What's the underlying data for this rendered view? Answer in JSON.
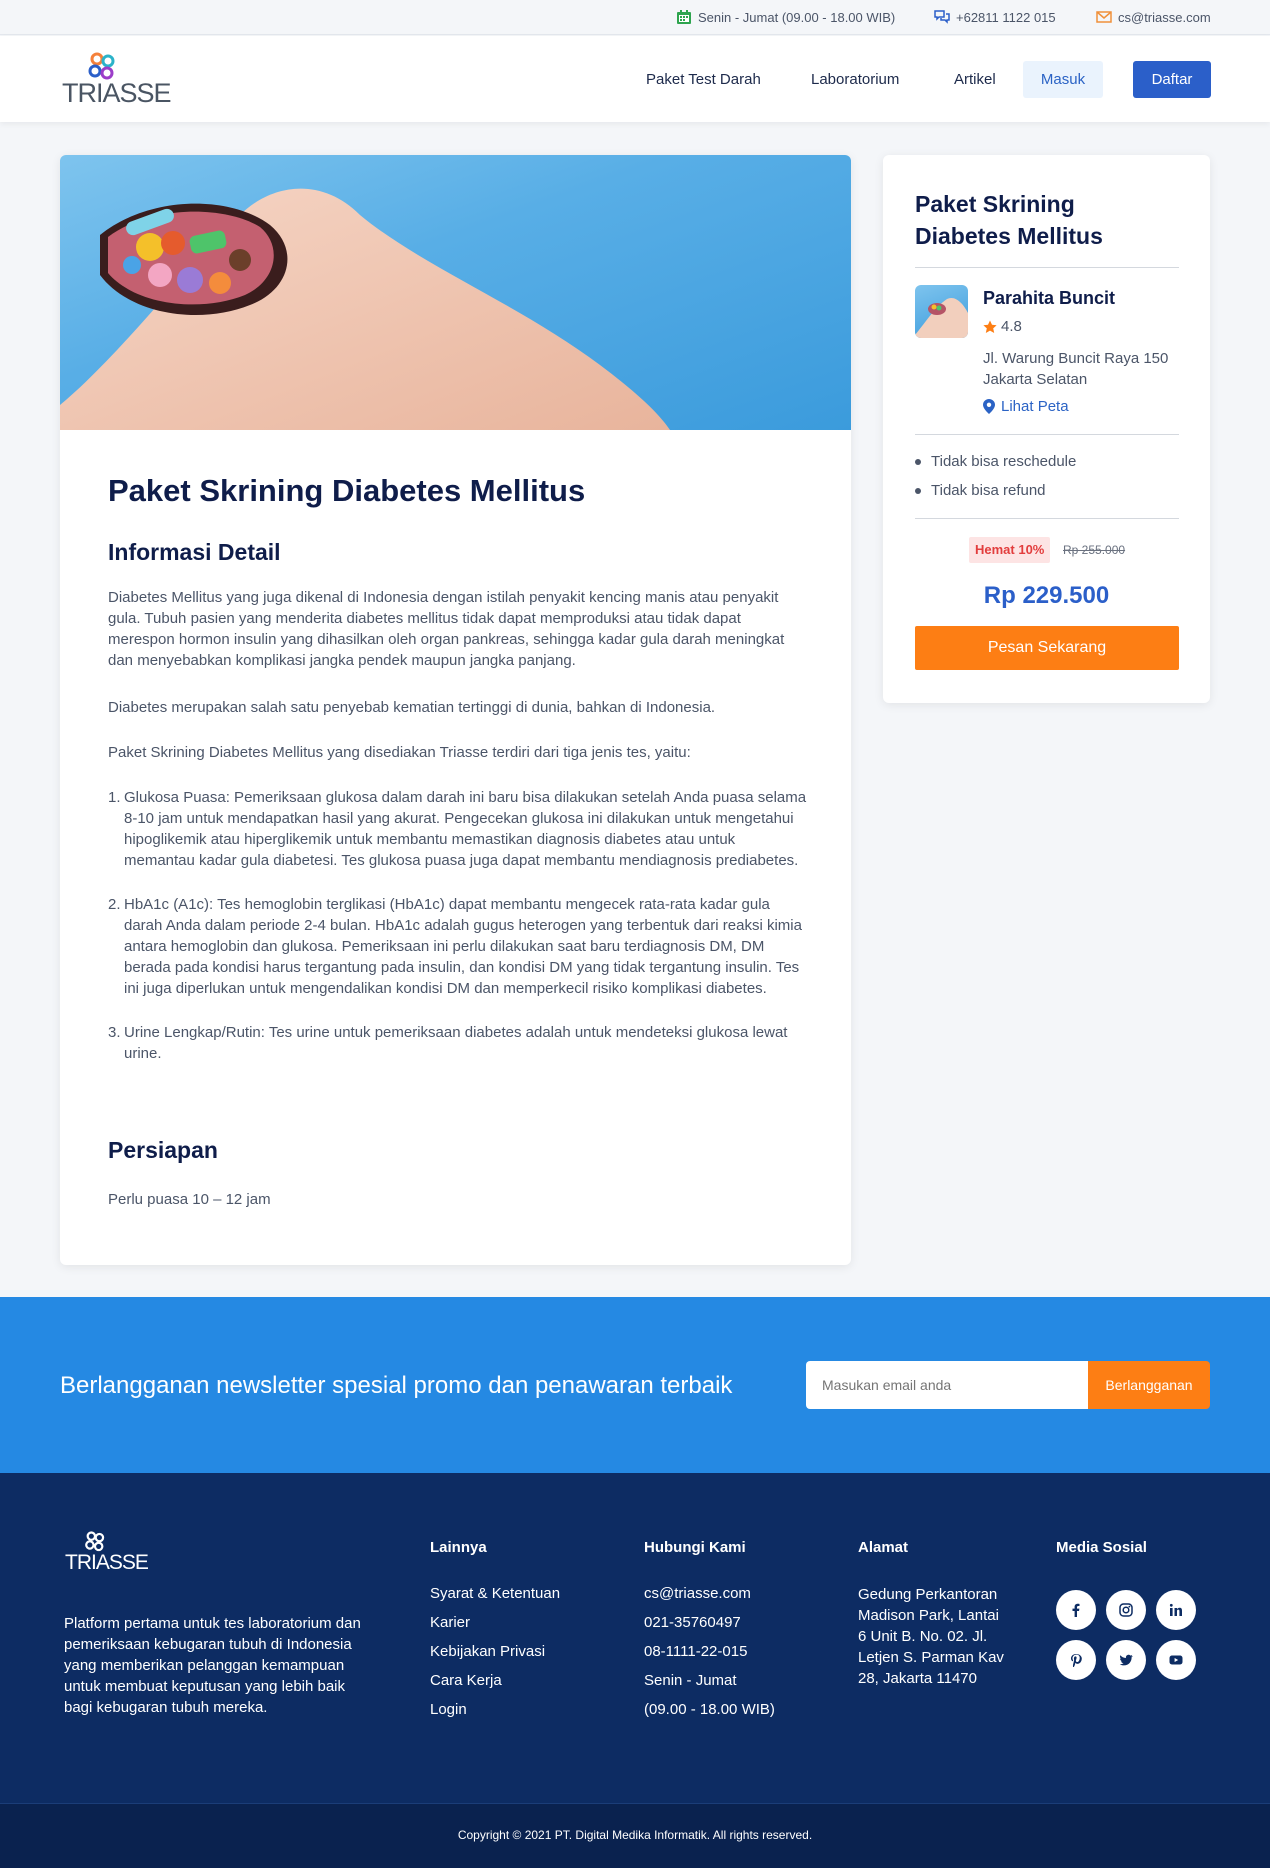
{
  "topbar": {
    "hours": "Senin - Jumat (09.00 - 18.00 WIB)",
    "phone": "+62811 1122 015",
    "email": "cs@triasse.com"
  },
  "header": {
    "logo_text": "TRIASSE",
    "nav": [
      "Paket Test Darah",
      "Laboratorium",
      "Artikel"
    ],
    "login_label": "Masuk",
    "register_label": "Daftar"
  },
  "main": {
    "title": "Paket Skrining Diabetes Mellitus",
    "detail_heading": "Informasi Detail",
    "paragraphs": [
      "Diabetes Mellitus yang juga dikenal di Indonesia dengan istilah penyakit kencing manis atau penyakit gula. Tubuh pasien yang menderita diabetes mellitus tidak dapat memproduksi atau tidak dapat merespon hormon insulin yang dihasilkan oleh organ pankreas, sehingga kadar gula darah meningkat dan menyebabkan komplikasi jangka pendek maupun jangka panjang.",
      "Diabetes merupakan salah satu penyebab kematian tertinggi di dunia, bahkan di Indonesia.",
      "Paket Skrining Diabetes Mellitus yang disediakan Triasse terdiri dari tiga jenis tes, yaitu:"
    ],
    "tests": [
      {
        "num": "1.",
        "text": "Glukosa Puasa: Pemeriksaan glukosa dalam darah ini baru bisa dilakukan setelah Anda puasa selama 8-10 jam untuk mendapatkan hasil yang akurat. Pengecekan glukosa ini dilakukan untuk mengetahui hipoglikemik atau hiperglikemik untuk membantu memastikan diagnosis diabetes atau untuk memantau kadar gula diabetesi. Tes glukosa puasa juga dapat membantu mendiagnosis prediabetes."
      },
      {
        "num": "2.",
        "text": "HbA1c (A1c): Tes hemoglobin terglikasi (HbA1c) dapat membantu mengecek rata-rata kadar gula darah Anda dalam periode 2-4 bulan. HbA1c adalah gugus heterogen yang terbentuk dari reaksi kimia antara hemoglobin dan glukosa. Pemeriksaan ini perlu dilakukan saat baru terdiagnosis DM, DM berada pada kondisi harus tergantung pada insulin, dan kondisi DM yang tidak tergantung insulin. Tes ini juga diperlukan untuk mengendalikan kondisi DM dan memperkecil risiko komplikasi diabetes."
      },
      {
        "num": "3.",
        "text": "Urine Lengkap/Rutin: Tes urine untuk pemeriksaan diabetes adalah untuk mendeteksi glukosa lewat urine."
      }
    ],
    "prep_heading": "Persiapan",
    "prep_text": "Perlu puasa 10 – 12 jam"
  },
  "side": {
    "title": "Paket Skrining Diabetes Mellitus",
    "lab_name": "Parahita Buncit",
    "rating": "4.8",
    "address": "Jl. Warung Buncit Raya 150 Jakarta Selatan",
    "map_label": "Lihat Peta",
    "policies": [
      "Tidak bisa reschedule",
      "Tidak bisa refund"
    ],
    "discount": "Hemat 10%",
    "old_price": "Rp 255.000",
    "price": "Rp 229.500",
    "order_label": "Pesan Sekarang"
  },
  "newsletter": {
    "text": "Berlangganan newsletter spesial promo dan penawaran terbaik",
    "placeholder": "Masukan email anda",
    "button": "Berlangganan"
  },
  "footer": {
    "logo_text": "TRIASSE",
    "description": "Platform pertama untuk tes laboratorium dan pemeriksaan kebugaran tubuh di Indonesia yang memberikan pelanggan kemampuan untuk membuat keputusan yang lebih baik bagi kebugaran tubuh mereka.",
    "others_heading": "Lainnya",
    "others": [
      "Syarat & Ketentuan",
      "Karier",
      "Kebijakan Privasi",
      "Cara Kerja",
      "Login"
    ],
    "contact_heading": "Hubungi Kami",
    "contact": [
      "cs@triasse.com",
      "021-35760497",
      "08-1111-22-015",
      "Senin - Jumat",
      "(09.00 - 18.00 WIB)"
    ],
    "address_heading": "Alamat",
    "address": "Gedung Perkantoran Madison Park, Lantai 6 Unit B. No. 02. Jl. Letjen S. Parman Kav 28, Jakarta 11470",
    "social_heading": "Media Sosial",
    "social_icons": [
      "facebook-icon",
      "instagram-icon",
      "linkedin-icon",
      "pinterest-icon",
      "twitter-icon",
      "youtube-icon"
    ],
    "copyright": "Copyright © 2021 PT. Digital Medika Informatik. All rights reserved."
  },
  "colors": {
    "primary": "#2b5fc9",
    "accent": "#fd7e14",
    "newsletter_bg": "#2589e3",
    "footer_bg": "#0d2c63",
    "discount_text": "#e23d3d"
  }
}
